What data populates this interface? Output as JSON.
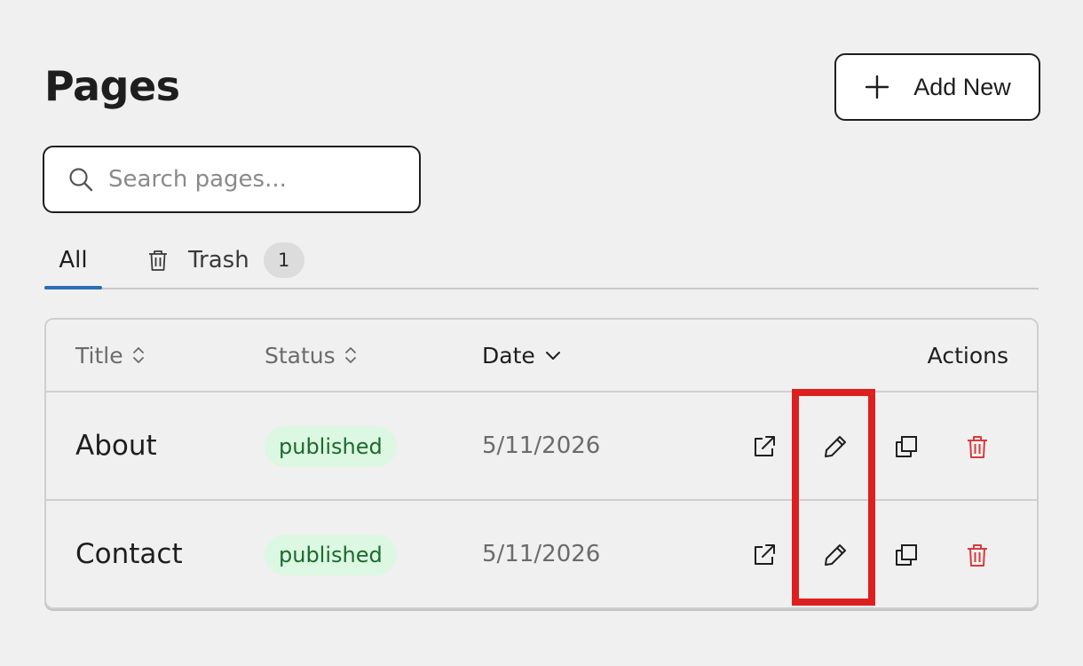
{
  "header": {
    "title": "Pages",
    "add_label": "Add New"
  },
  "search": {
    "placeholder": "Search pages...",
    "value": ""
  },
  "tabs": [
    {
      "label": "All",
      "active": true
    },
    {
      "label": "Trash",
      "count": "1",
      "active": false
    }
  ],
  "table": {
    "headers": {
      "title": "Title",
      "status": "Status",
      "date": "Date",
      "actions": "Actions"
    },
    "rows": [
      {
        "title": "About",
        "status": "published",
        "date": "5/11/2026"
      },
      {
        "title": "Contact",
        "status": "published",
        "date": "5/11/2026"
      }
    ]
  },
  "icons": {
    "add": "plus-icon",
    "search": "search-icon",
    "trash_tab": "trash-icon",
    "sort": "sort-icon",
    "sort_desc": "chevron-down-icon",
    "view": "external-link-icon",
    "edit": "pencil-icon",
    "duplicate": "copy-icon",
    "delete": "trash-icon"
  },
  "colors": {
    "accent": "#2a6fb6",
    "published_bg": "#dcf7e2",
    "published_text": "#1b6b2c",
    "delete": "#d93a3a",
    "highlight": "#dd1f1f"
  }
}
